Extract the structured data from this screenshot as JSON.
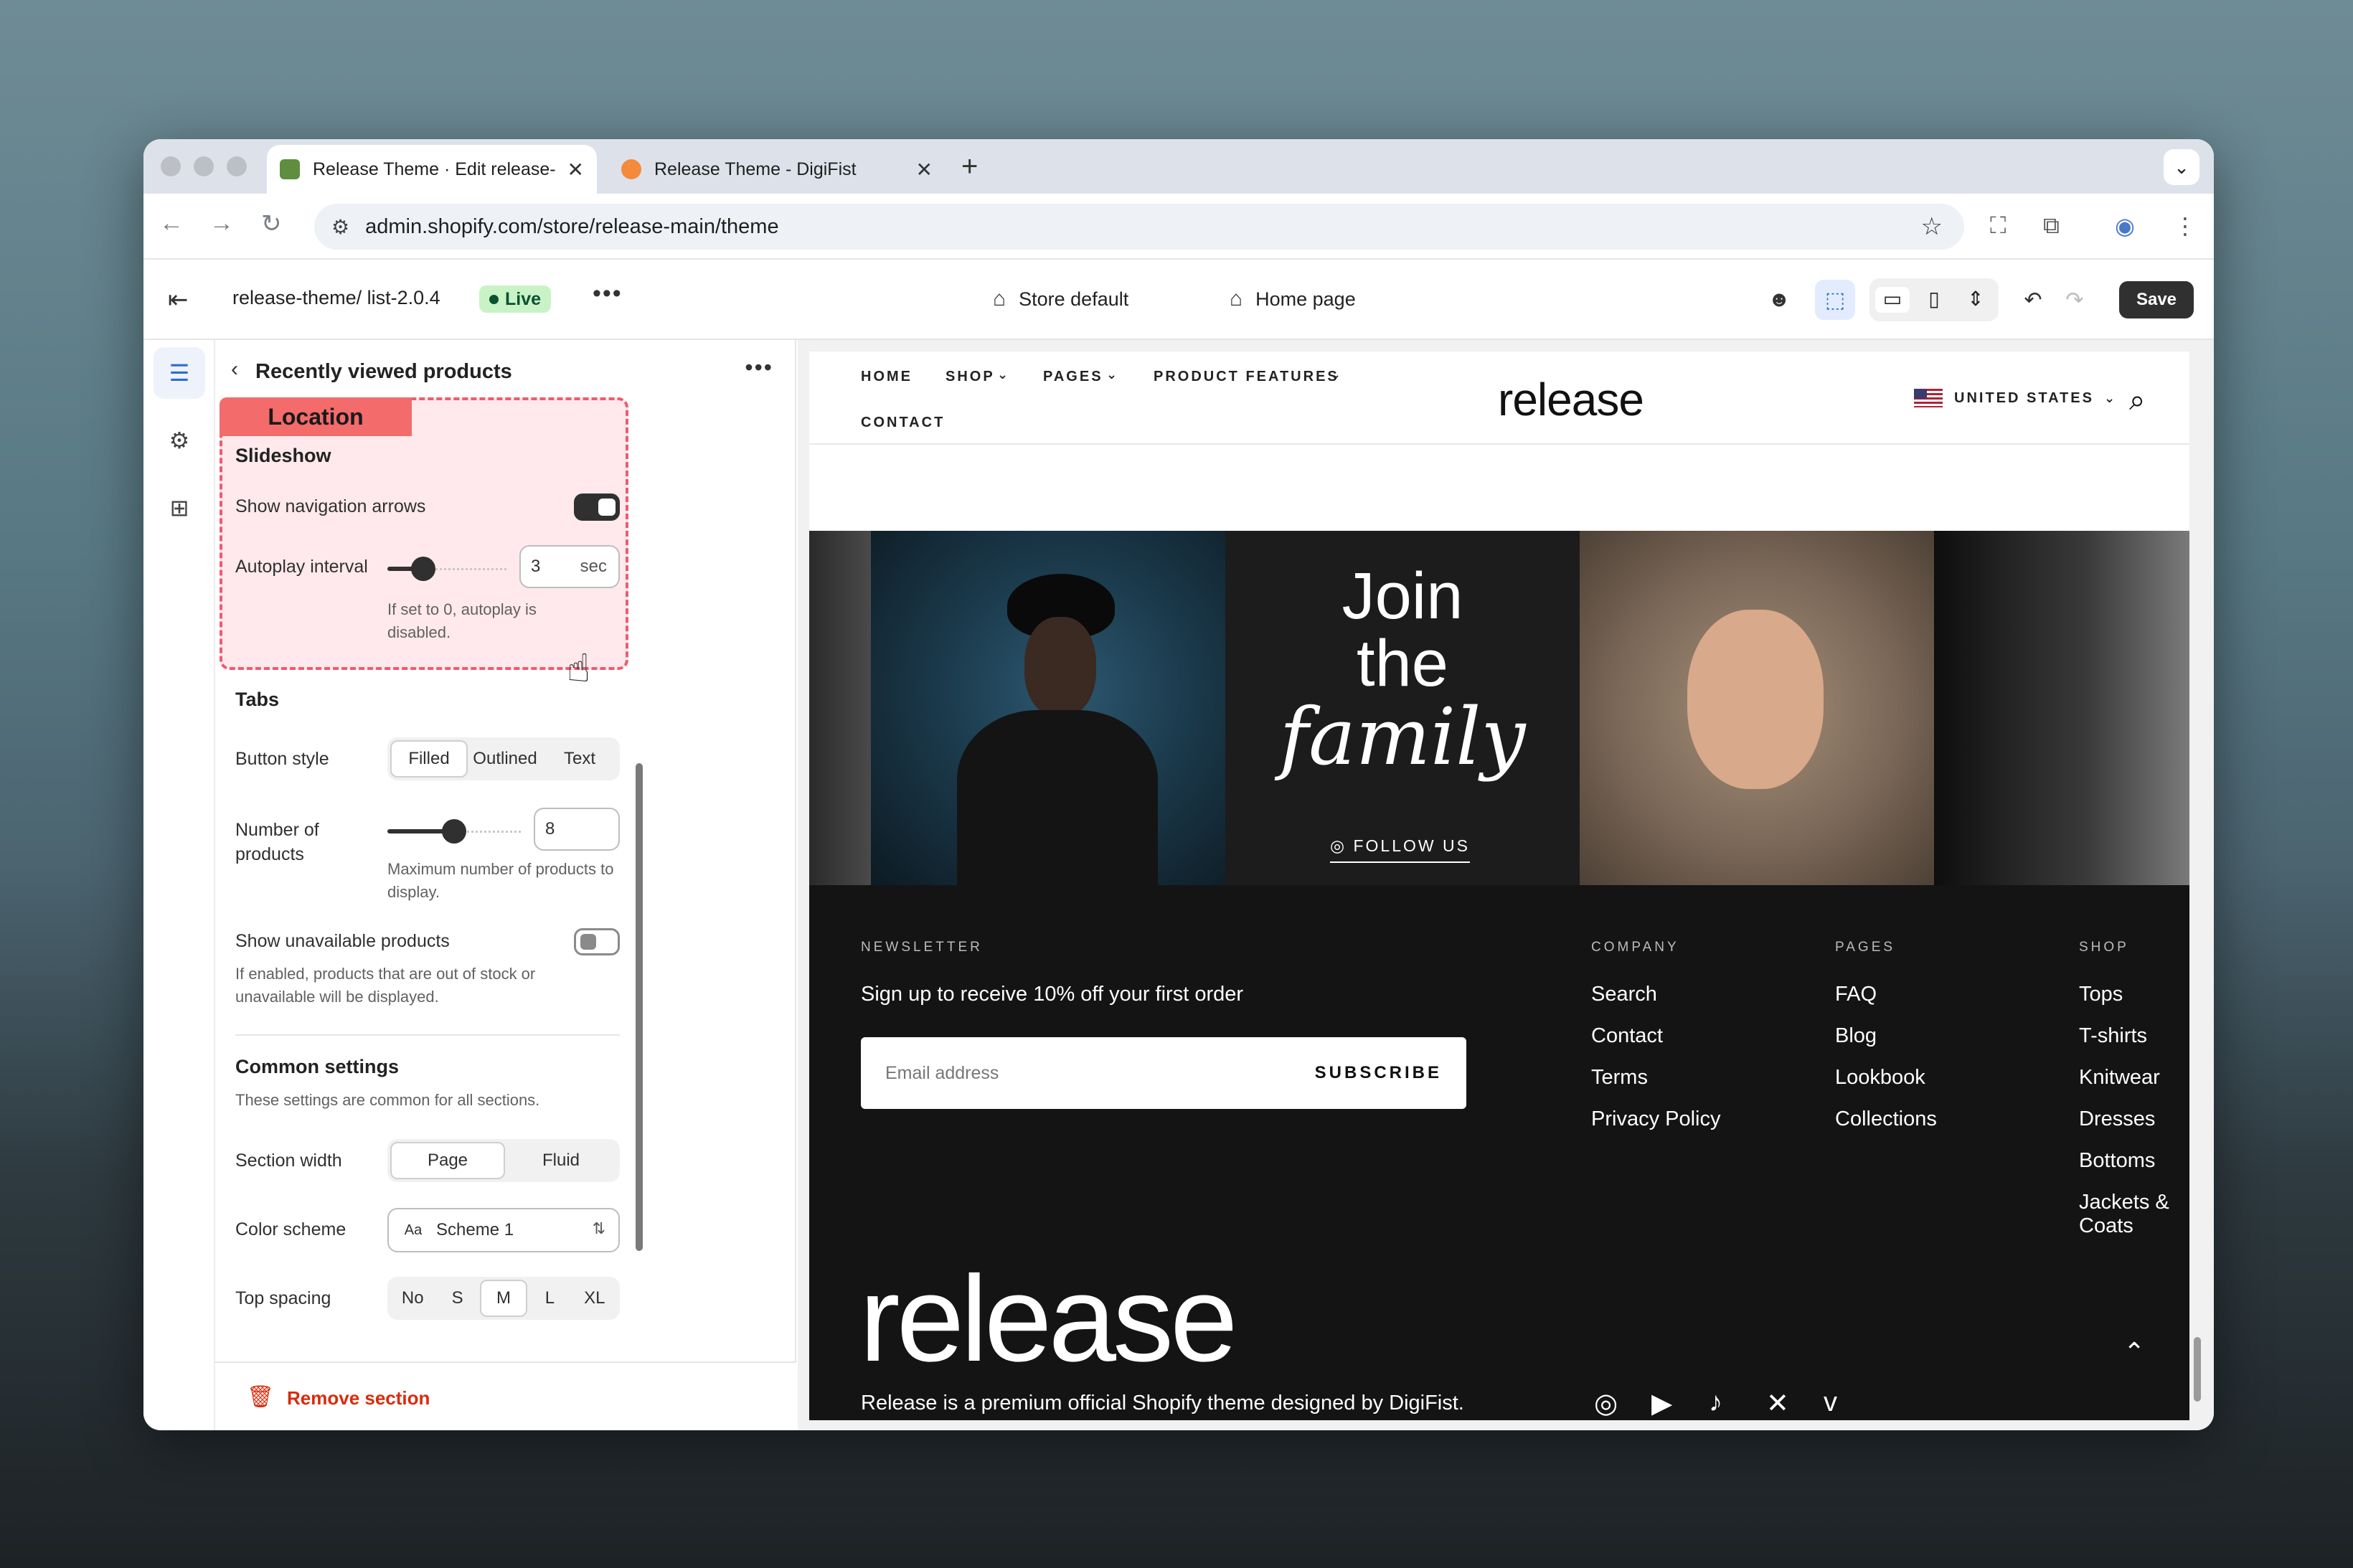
{
  "browser": {
    "tabs": [
      {
        "title": "Release Theme · Edit release-"
      },
      {
        "title": "Release Theme - DigiFist"
      }
    ],
    "close_glyph": "✕",
    "new_tab_glyph": "+",
    "url": "admin.shopify.com/store/release-main/theme"
  },
  "editor": {
    "theme_name": "release-theme/ list-2.0.4",
    "status_badge": "Live",
    "template_selector": "Store default",
    "page_selector": "Home page",
    "save_label": "Save"
  },
  "panel": {
    "title": "Recently viewed products",
    "location_label": "Location",
    "slideshow_heading": "Slideshow",
    "show_arrows_label": "Show navigation arrows",
    "show_arrows_on": true,
    "autoplay_label": "Autoplay interval",
    "autoplay_value": "3",
    "autoplay_unit": "sec",
    "autoplay_slider_fraction": 0.3,
    "autoplay_help": "If set to 0, autoplay is disabled.",
    "tabs_heading": "Tabs",
    "button_style_label": "Button style",
    "button_style_options": [
      "Filled",
      "Outlined",
      "Text"
    ],
    "button_style_selected": "Filled",
    "num_products_label": "Number of products",
    "num_products_value": "8",
    "num_products_slider_fraction": 0.5,
    "num_products_help": "Maximum number of products to display.",
    "unavailable_label": "Show unavailable products",
    "unavailable_on": false,
    "unavailable_help": "If enabled, products that are out of stock or unavailable will be displayed.",
    "common_heading": "Common settings",
    "common_help": "These settings are common for all sections.",
    "section_width_label": "Section width",
    "section_width_options": [
      "Page",
      "Fluid"
    ],
    "section_width_selected": "Page",
    "color_scheme_label": "Color scheme",
    "color_scheme_icon_text": "Aa",
    "color_scheme_value": "Scheme 1",
    "top_spacing_label": "Top spacing",
    "top_spacing_options": [
      "No",
      "S",
      "M",
      "L",
      "XL"
    ],
    "top_spacing_selected": "M",
    "remove_label": "Remove section"
  },
  "store": {
    "nav": [
      "HOME",
      "SHOP",
      "PAGES",
      "PRODUCT FEATURES",
      "CONTACT"
    ],
    "logo": "release",
    "country": "UNITED STATES",
    "join_line1": "Join",
    "join_line2": "the",
    "join_line3": "family",
    "follow_label": "FOLLOW US",
    "newsletter_heading": "NEWSLETTER",
    "newsletter_text": "Sign up to receive 10% off your first order",
    "email_placeholder": "Email address",
    "subscribe_label": "SUBSCRIBE",
    "company_heading": "COMPANY",
    "company_links": [
      "Search",
      "Contact",
      "Terms",
      "Privacy Policy"
    ],
    "pages_heading": "PAGES",
    "pages_links": [
      "FAQ",
      "Blog",
      "Lookbook",
      "Collections"
    ],
    "shop_heading": "SHOP",
    "shop_links": [
      "Tops",
      "T-shirts",
      "Knitwear",
      "Dresses",
      "Bottoms",
      "Jackets & Coats"
    ],
    "footer_logo": "release",
    "tagline": "Release is a premium official Shopify theme designed by DigiFist."
  },
  "colors": {
    "live_badge": "#c9f3c6",
    "highlight_border": "#ef5b6d",
    "location_label_bg": "#f36b6b",
    "remove_red": "#d72c0d",
    "save_bg": "#303030"
  }
}
